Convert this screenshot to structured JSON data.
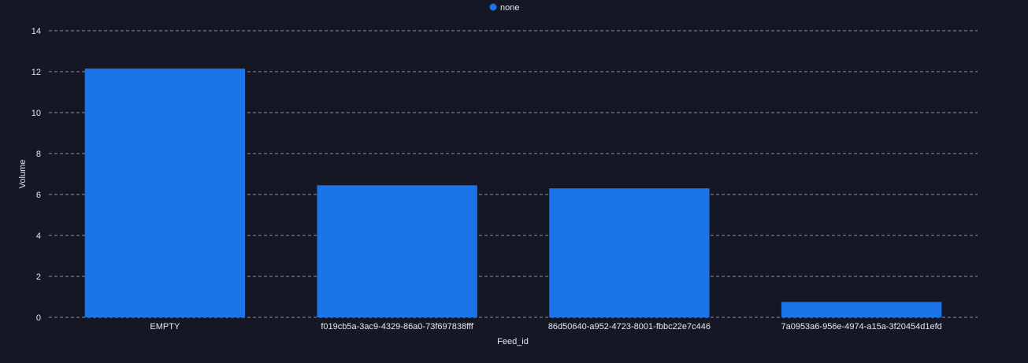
{
  "colors": {
    "background": "#161724",
    "bar": "#1b74e8",
    "text": "#e6e7ee",
    "grid": "#d8d9e0"
  },
  "chart_data": {
    "type": "bar",
    "categories": [
      "EMPTY",
      "f019cb5a-3ac9-4329-86a0-73f697838fff",
      "86d50640-a952-4723-8001-fbbc22e7c446",
      "7a0953a6-956e-4974-a15a-3f20454d1efd"
    ],
    "series": [
      {
        "name": "none",
        "values": [
          12.15,
          6.45,
          6.3,
          0.75
        ]
      }
    ],
    "title": "",
    "xlabel": "Feed_id",
    "ylabel": "Volume",
    "ylim": [
      0,
      14
    ],
    "yticks": [
      "0",
      "2",
      "4",
      "6",
      "8",
      "10",
      "12",
      "14"
    ],
    "grid": true,
    "legend_position": "top-center"
  }
}
